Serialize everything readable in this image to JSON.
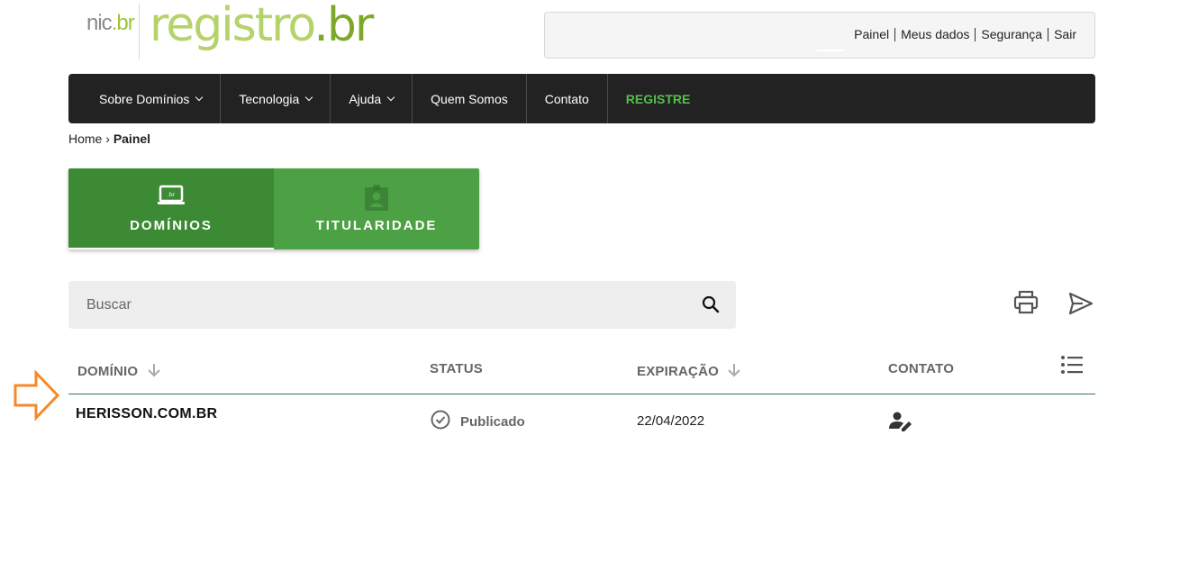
{
  "logo": {
    "nic": "nic",
    "nic_br": ".br",
    "brand": "registro",
    "brand_br": ".br"
  },
  "user_menu": [
    "Painel",
    "Meus dados",
    "Segurança",
    "Sair"
  ],
  "nav": {
    "items": [
      {
        "label": "Sobre Domínios",
        "dropdown": true
      },
      {
        "label": "Tecnologia",
        "dropdown": true
      },
      {
        "label": "Ajuda",
        "dropdown": true
      },
      {
        "label": "Quem Somos",
        "dropdown": false
      },
      {
        "label": "Contato",
        "dropdown": false
      },
      {
        "label": "REGISTRE",
        "dropdown": false,
        "highlight": true
      }
    ]
  },
  "breadcrumb": {
    "home": "Home",
    "separator": "›",
    "current": "Painel"
  },
  "tabs": [
    {
      "label": "DOMÍNIOS",
      "icon": "laptop-br-icon",
      "active": true
    },
    {
      "label": "TITULARIDADE",
      "icon": "id-badge-icon",
      "active": false
    }
  ],
  "search": {
    "placeholder": "Buscar",
    "value": ""
  },
  "table": {
    "headers": {
      "domain": "DOMÍNIO",
      "status": "STATUS",
      "expiration": "EXPIRAÇÃO",
      "contact": "CONTATO"
    },
    "rows": [
      {
        "domain": "HERISSON.COM.BR",
        "status": "Publicado",
        "expiration": "22/04/2022"
      }
    ]
  },
  "colors": {
    "nav_bg": "#222222",
    "tab_active": "#3c8a34",
    "tab_inactive": "#4da145",
    "registre_green": "#55c04a",
    "annotation_arrow": "#f5892a"
  }
}
